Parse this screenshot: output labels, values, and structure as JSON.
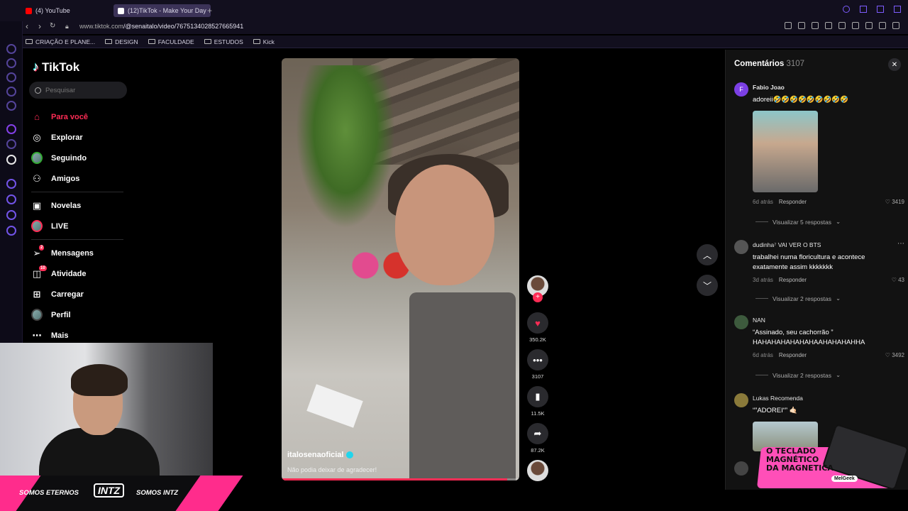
{
  "browser": {
    "tabs": [
      {
        "label": "(4) YouTube",
        "favicon_color": "#ff0000"
      },
      {
        "label": "(12)TikTok - Make Your Day",
        "favicon_color": "#ffffff"
      }
    ],
    "url_host": "www.tiktok.com",
    "url_path": "/@senaitalo/video/7675134028527665941",
    "bookmarks": [
      "CRIAÇÃO E PLANE...",
      "DESIGN",
      "FACULDADE",
      "ESTUDOS",
      "Kick"
    ]
  },
  "tiktok": {
    "logo": "TikTok",
    "search_placeholder": "Pesquisar",
    "nav": [
      {
        "label": "Para você",
        "icon": "home-icon"
      },
      {
        "label": "Explorar",
        "icon": "compass-icon"
      },
      {
        "label": "Seguindo",
        "icon": "following-icon"
      },
      {
        "label": "Amigos",
        "icon": "friends-icon"
      },
      {
        "label": "Novelas",
        "icon": "novelas-icon"
      },
      {
        "label": "LIVE",
        "icon": "live-icon"
      },
      {
        "label": "Mensagens",
        "icon": "messages-icon",
        "badge": "2"
      },
      {
        "label": "Atividade",
        "icon": "activity-icon",
        "badge": "10"
      },
      {
        "label": "Carregar",
        "icon": "upload-icon"
      },
      {
        "label": "Perfil",
        "icon": "profile-icon"
      },
      {
        "label": "Mais",
        "icon": "more-icon"
      }
    ],
    "video": {
      "username": "italosenaoficial",
      "caption": "Não podia deixar de agradecer!",
      "progress": 0.95
    },
    "actions": {
      "likes": "350.2K",
      "comments": "3107",
      "saves": "11.5K",
      "shares": "87.2K"
    },
    "comments_panel": {
      "title": "Comentários",
      "count": "3107",
      "comments": [
        {
          "user": "Fabio Joao",
          "text": "adoreii🤣🤣🤣🤣🤣🤣🤣🤣🤣",
          "time": "6d atrás",
          "reply": "Responder",
          "likes": "3419",
          "replies": "Visualizar 5 respostas",
          "avatar_color": "#7b3fe4"
        },
        {
          "user": "dudinha⁷ VAI VER O BTS",
          "text": "trabalhei numa floricultura e acontece exatamente assim kkkkkkk",
          "time": "3d atrás",
          "reply": "Responder",
          "likes": "43",
          "replies": "Visualizar 2 respostas",
          "avatar_color": "#555555"
        },
        {
          "user": "NAN",
          "text": "“Assinado, seu cachorrão ” HAHAHAHAHAHAHAAHAHAHAHHA",
          "time": "6d atrás",
          "reply": "Responder",
          "likes": "3492",
          "replies": "Visualizar 2 respostas",
          "avatar_color": "#3d5a3d"
        },
        {
          "user": "Lukas Recomenda",
          "text": "“”ADOREI“” 🤙🏻",
          "avatar_color": "#8a7a3a"
        }
      ]
    }
  },
  "ad": {
    "title_line1": "O TECLADO",
    "title_line2": "MAGNÉTICO",
    "title_line3": "DA MAGNETICA",
    "brand": "MelGeek"
  },
  "stream_overlay": {
    "left_text": "SOMOS ETERNOS",
    "logo": "INTZ",
    "right_text": "SOMOS INTZ"
  }
}
